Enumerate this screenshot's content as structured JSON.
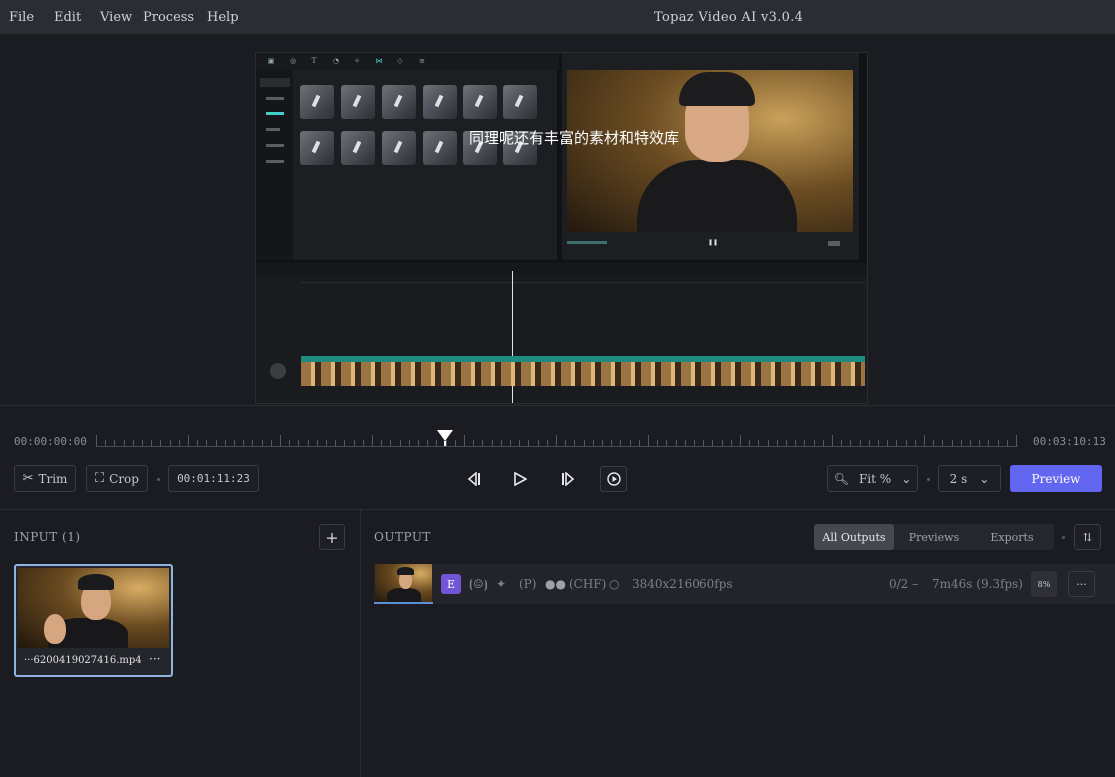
{
  "menu": [
    "File",
    "Edit",
    "View",
    "Process",
    "Help"
  ],
  "app_title": "Topaz Video AI  v3.0.4",
  "viewer": {
    "subtitle": "同理呢还有丰富的素材和特效库"
  },
  "scrubber": {
    "start_time": "00:00:00:00",
    "end_time": "00:03:10:13",
    "playhead_fraction": 0.378
  },
  "controls": {
    "trim_label": "Trim",
    "crop_label": "Crop",
    "current_time": "00:01:11:23",
    "zoom_label": "Fit %",
    "duration_label": "2 s",
    "preview_label": "Preview"
  },
  "input_panel": {
    "label": "INPUT (1)",
    "file_name": "···6200419027416.mp4",
    "more": "···"
  },
  "output_panel": {
    "label": "OUTPUT",
    "tabs": [
      "All Outputs",
      "Previews",
      "Exports"
    ],
    "active_tab": 0,
    "row": {
      "badge": "E",
      "p_label": "(P)",
      "chf_label": "(CHF)",
      "resolution": "3840x2160",
      "fps": "60fps",
      "progress": "0/2 –",
      "eta": "7m46s (9.3fps)",
      "percent": "8%",
      "more": "···"
    }
  }
}
